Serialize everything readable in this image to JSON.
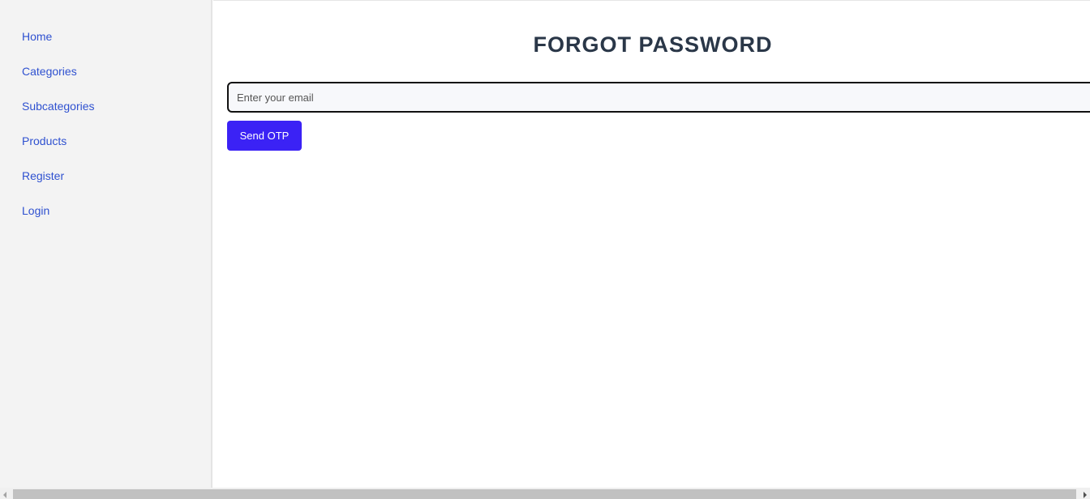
{
  "sidebar": {
    "items": [
      {
        "label": "Home"
      },
      {
        "label": "Categories"
      },
      {
        "label": "Subcategories"
      },
      {
        "label": "Products"
      },
      {
        "label": "Register"
      },
      {
        "label": "Login"
      }
    ]
  },
  "main": {
    "title": "FORGOT PASSWORD",
    "email_input": {
      "placeholder": "Enter your email",
      "value": ""
    },
    "send_button_label": "Send OTP"
  },
  "colors": {
    "link": "#2f51d0",
    "title": "#2a3748",
    "button": "#3b22f5",
    "sidebar_bg": "#f3f3f3"
  }
}
